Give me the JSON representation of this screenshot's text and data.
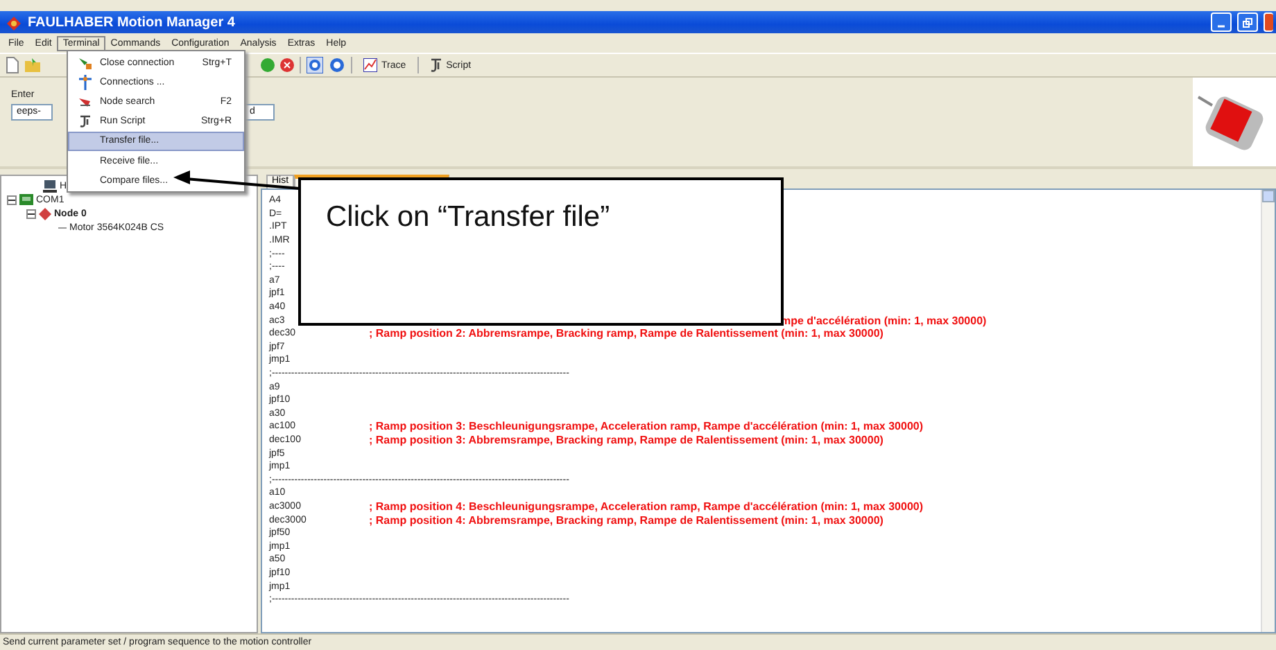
{
  "window": {
    "title": "FAULHABER Motion Manager 4"
  },
  "menu_bar": [
    {
      "label": "File",
      "selected": false
    },
    {
      "label": "Edit",
      "selected": false
    },
    {
      "label": "Terminal",
      "selected": true
    },
    {
      "label": "Commands",
      "selected": false
    },
    {
      "label": "Configuration",
      "selected": false
    },
    {
      "label": "Analysis",
      "selected": false
    },
    {
      "label": "Extras",
      "selected": false
    },
    {
      "label": "Help",
      "selected": false
    }
  ],
  "open_menu": {
    "items": [
      {
        "label": "Close connection",
        "shortcut": "Strg+T",
        "selected": false
      },
      {
        "label": "Connections ...",
        "selected": false
      },
      {
        "label": "Node search",
        "shortcut": "F2",
        "selected": false
      },
      {
        "label": "Run Script",
        "shortcut": "Strg+R",
        "selected": false
      },
      {
        "label": "Transfer file...",
        "selected": true
      },
      {
        "label": "Receive file...",
        "selected": false
      },
      {
        "label": "Compare files...",
        "selected": false
      }
    ]
  },
  "toolbar": {
    "buttons": [
      "Trace",
      "Script"
    ]
  },
  "parameter_panel": {
    "label": "Enter",
    "field_value": "eeps-",
    "second_field_value": "d"
  },
  "tree": [
    {
      "label": "H",
      "kind": "host"
    },
    {
      "label": "COM1",
      "kind": "port",
      "expanded": true,
      "children": [
        {
          "label": "Node 0",
          "kind": "node",
          "expanded": true,
          "children": [
            {
              "label": "Motor 3564K024B CS",
              "kind": "motor"
            }
          ]
        }
      ]
    }
  ],
  "editor": {
    "tabs": [
      {
        "label": "Hist",
        "selected": false
      },
      {
        "selected": true
      }
    ],
    "lines": [
      {
        "code": "A4"
      },
      {
        "code": "D="
      },
      {
        "code": ".IPT"
      },
      {
        "code": ".IMR"
      },
      {
        "code": ";----"
      },
      {
        "code": ";----"
      },
      {
        "code": "a7"
      },
      {
        "code": "jpf1"
      },
      {
        "code": "a40"
      },
      {
        "code": "ac3",
        "comment": "mpe d'accélération (min: 1, max 30000)",
        "kind": "partial"
      },
      {
        "code": "dec30",
        "comment": "; Ramp position 2: Abbremsrampe, Bracking ramp, Rampe de Ralentissement (min: 1, max 30000)",
        "kind": "full"
      },
      {
        "code": "jpf7"
      },
      {
        "code": "jmp1"
      },
      {
        "code": ";--------------------------------------------------------------------------------------------"
      },
      {
        "code": "a9"
      },
      {
        "code": "jpf10"
      },
      {
        "code": "a30"
      },
      {
        "code": "ac100",
        "comment": "; Ramp position 3: Beschleunigungsrampe, Acceleration ramp, Rampe d'accélération (min: 1, max 30000)",
        "kind": "full"
      },
      {
        "code": "dec100",
        "comment": "; Ramp position 3: Abbremsrampe, Bracking ramp, Rampe de Ralentissement (min: 1, max 30000)",
        "kind": "full"
      },
      {
        "code": "jpf5"
      },
      {
        "code": "jmp1"
      },
      {
        "code": ";--------------------------------------------------------------------------------------------"
      },
      {
        "code": "a10"
      },
      {
        "code": "ac3000",
        "comment": "; Ramp position 4: Beschleunigungsrampe, Acceleration ramp, Rampe d'accélération (min: 1, max 30000)",
        "kind": "full"
      },
      {
        "code": "dec3000",
        "comment": "; Ramp position 4: Abbremsrampe, Bracking ramp, Rampe de Ralentissement (min: 1, max 30000)",
        "kind": "full"
      },
      {
        "code": "jpf50"
      },
      {
        "code": "jmp1"
      },
      {
        "code": "a50"
      },
      {
        "code": "jpf10"
      },
      {
        "code": "jmp1"
      },
      {
        "code": ";--------------------------------------------------------------------------------------------"
      }
    ]
  },
  "callout": {
    "text": "Click on “Transfer file”"
  },
  "status_bar": {
    "text": "Send current parameter set / program sequence to the motion controller"
  }
}
